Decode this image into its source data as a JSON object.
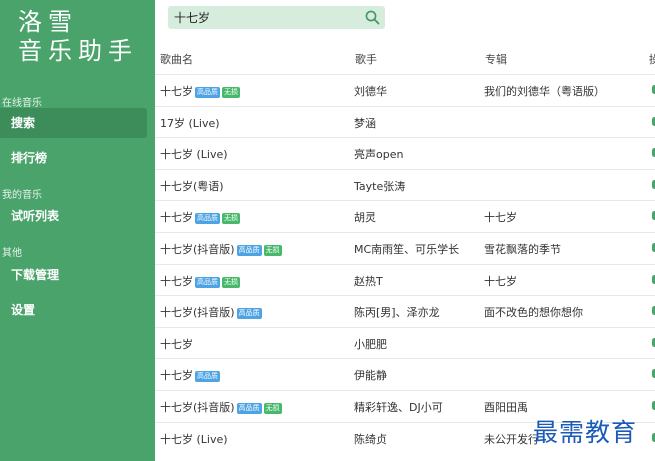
{
  "app": {
    "logo_line1": "洛雪",
    "logo_line2": "音乐助手"
  },
  "sidebar": {
    "section_online": "在线音乐",
    "section_my": "我的音乐",
    "section_other": "其他",
    "items": [
      {
        "label": "搜索",
        "active": true
      },
      {
        "label": "排行榜"
      },
      {
        "label": "试听列表"
      },
      {
        "label": "下载管理"
      },
      {
        "label": "设置"
      }
    ]
  },
  "search": {
    "value": "十七岁",
    "icon": "search-icon"
  },
  "table": {
    "headers": [
      "歌曲名",
      "歌手",
      "专辑",
      "操"
    ],
    "badges": {
      "hq": "高品质",
      "lossless": "无损"
    },
    "rows": [
      {
        "title": "十七岁",
        "hq": true,
        "lossless": true,
        "artist": "刘德华",
        "album": "我们的刘德华（粤语版）"
      },
      {
        "title": "17岁 (Live)",
        "hq": false,
        "lossless": false,
        "artist": "梦涵",
        "album": ""
      },
      {
        "title": "十七岁 (Live)",
        "hq": false,
        "lossless": false,
        "artist": "亮声open",
        "album": ""
      },
      {
        "title": "十七岁(粤语)",
        "hq": false,
        "lossless": false,
        "artist": "Tayte张涛",
        "album": ""
      },
      {
        "title": "十七岁",
        "hq": true,
        "lossless": true,
        "artist": "胡灵",
        "album": "十七岁"
      },
      {
        "title": "十七岁(抖音版)",
        "hq": true,
        "lossless": true,
        "artist": "MC南雨笙、可乐学长",
        "album": "雪花飘落的季节"
      },
      {
        "title": "十七岁",
        "hq": true,
        "lossless": true,
        "artist": "赵热T",
        "album": "十七岁"
      },
      {
        "title": "十七岁(抖音版)",
        "hq": true,
        "lossless": false,
        "artist": "陈丙[男]、泽亦龙",
        "album": "面不改色的想你想你"
      },
      {
        "title": "十七岁",
        "hq": false,
        "lossless": false,
        "artist": "小肥肥",
        "album": ""
      },
      {
        "title": "十七岁",
        "hq": true,
        "lossless": false,
        "artist": "伊能静",
        "album": ""
      },
      {
        "title": "十七岁(抖音版)",
        "hq": true,
        "lossless": true,
        "artist": "精彩轩逸、DJ小可",
        "album": "酉阳田禹"
      },
      {
        "title": "十七岁 (Live)",
        "hq": false,
        "lossless": false,
        "artist": "陈绮贞",
        "album": "未公开发行"
      }
    ]
  },
  "watermark": "最需教育",
  "colors": {
    "sidebar_bg": "#4aa36b",
    "active_item_bg": "#3d8d5b",
    "search_bg": "#d6ecdc",
    "badge_hq": "#4da3e4",
    "badge_lossless": "#48b86b",
    "watermark": "#1a5bb8"
  }
}
